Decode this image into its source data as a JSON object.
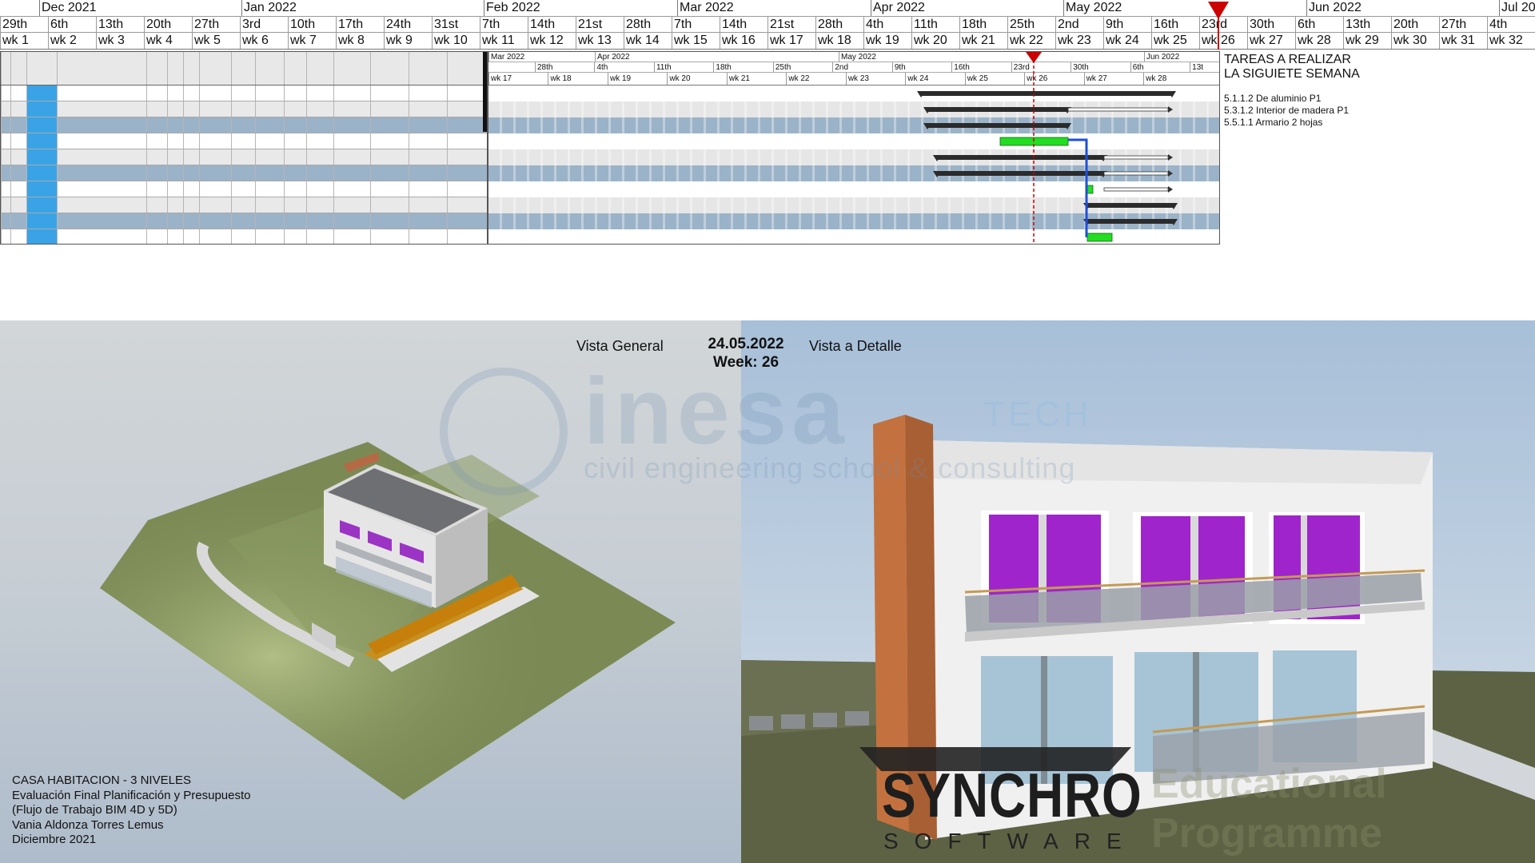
{
  "timeline": {
    "months": [
      "Dec 2021",
      "Jan 2022",
      "Feb 2022",
      "Mar 2022",
      "Apr 2022",
      "May 2022",
      "Jun 2022",
      "Jul 20"
    ],
    "days": [
      "29th",
      "6th",
      "13th",
      "20th",
      "27th",
      "3rd",
      "10th",
      "17th",
      "24th",
      "31st",
      "7th",
      "14th",
      "21st",
      "28th",
      "7th",
      "14th",
      "21st",
      "28th",
      "4th",
      "11th",
      "18th",
      "25th",
      "2nd",
      "9th",
      "16th",
      "23rd",
      "30th",
      "6th",
      "13th",
      "20th",
      "27th",
      "4th"
    ],
    "weeks": [
      "wk 1",
      "wk 2",
      "wk 3",
      "wk 4",
      "wk 5",
      "wk 6",
      "wk 7",
      "wk 8",
      "wk 9",
      "wk 10",
      "wk 11",
      "wk 12",
      "wk 13",
      "wk 14",
      "wk 15",
      "wk 16",
      "wk 17",
      "wk 18",
      "wk 19",
      "wk 20",
      "wk 21",
      "wk 22",
      "wk 23",
      "wk 24",
      "wk 25",
      "wk 26",
      "wk 27",
      "wk 28",
      "wk 29",
      "wk 30",
      "wk 31",
      "wk 32"
    ]
  },
  "gantt": {
    "months": [
      "Mar 2022",
      "Apr 2022",
      "May 2022",
      "Jun 2022"
    ],
    "days": [
      "28th",
      "4th",
      "11th",
      "18th",
      "25th",
      "2nd",
      "9th",
      "16th",
      "23rd",
      "30th",
      "6th",
      "13t"
    ],
    "weeks": [
      "wk 17",
      "wk 18",
      "wk 19",
      "wk 20",
      "wk 21",
      "wk 22",
      "wk 23",
      "wk 24",
      "wk 25",
      "wk 26",
      "wk 27",
      "wk 28"
    ]
  },
  "side_notes": {
    "title_line1": "TAREAS A REALIZAR",
    "title_line2": "LA SIGUIETE SEMANA",
    "items": [
      "5.1.1.2 De aluminio P1",
      "5.3.1.2 Interior de madera P1",
      "5.5.1.1 Armario 2 hojas"
    ]
  },
  "views": {
    "general_label": "Vista General",
    "detail_label": "Vista a Detalle",
    "date": "24.05.2022",
    "week": "Week: 26"
  },
  "watermark": {
    "brand": "inesa",
    "brand_suffix": "TECH",
    "tagline": "civil engineering school & consulting"
  },
  "project_info": {
    "line1": "CASA HABITACION - 3 NIVELES",
    "line2": "Evaluación Final Planificación y Presupuesto",
    "line3": "(Flujo de Trabajo BIM 4D y 5D)",
    "line4": "Vania Aldonza Torres Lemus",
    "line5": "Diciembre 2021"
  },
  "synchro": {
    "word": "SYNCHRO",
    "sub": "SOFTWARE",
    "edu_line1": "Educational",
    "edu_line2": "Programme"
  },
  "colors": {
    "accent_red": "#cc0000",
    "task_green": "#22dd22",
    "summary_bar": "#2b2b2b",
    "link_blue": "#1f4fd8",
    "id_blue": "#3aa3e6",
    "selected_row": "#9bb3c8"
  }
}
